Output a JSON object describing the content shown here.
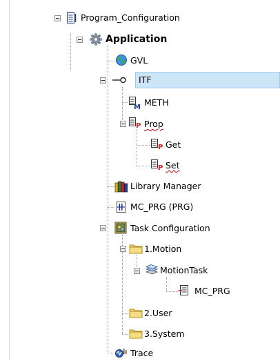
{
  "tree": {
    "root": {
      "label": "Program_Configuration",
      "icon": "project-document-icon"
    },
    "application": {
      "label": "Application",
      "icon": "gear-icon"
    },
    "gvl": {
      "label": "GVL",
      "icon": "globe-icon"
    },
    "itf": {
      "label": "ITF",
      "icon": "interface-lollipop-icon"
    },
    "meth": {
      "label": "METH",
      "icon": "method-icon"
    },
    "prop": {
      "label": "Prop",
      "icon": "property-icon"
    },
    "get": {
      "label": "Get",
      "icon": "property-accessor-icon"
    },
    "set": {
      "label": "Set",
      "icon": "property-accessor-icon"
    },
    "library_manager": {
      "label": "Library Manager",
      "icon": "library-books-icon"
    },
    "mc_prg": {
      "label": "MC_PRG (PRG)",
      "icon": "program-icon"
    },
    "task_config": {
      "label": "Task Configuration",
      "icon": "task-configuration-icon"
    },
    "motion_folder": {
      "label": "1.Motion",
      "icon": "folder-icon"
    },
    "motion_task": {
      "label": "MotionTask",
      "icon": "task-icon"
    },
    "task_mc_prg": {
      "label": "MC_PRG",
      "icon": "program-call-icon"
    },
    "user_folder": {
      "label": "2.User",
      "icon": "folder-icon"
    },
    "system_folder": {
      "label": "3.System",
      "icon": "folder-icon"
    },
    "trace": {
      "label": "Trace",
      "icon": "trace-icon"
    }
  },
  "colors": {
    "selection_fill": "#cde6f7",
    "selection_border": "#99c9ef",
    "spellcheck_underline": "#e00000",
    "tree_lines": "#9a9a9a"
  }
}
